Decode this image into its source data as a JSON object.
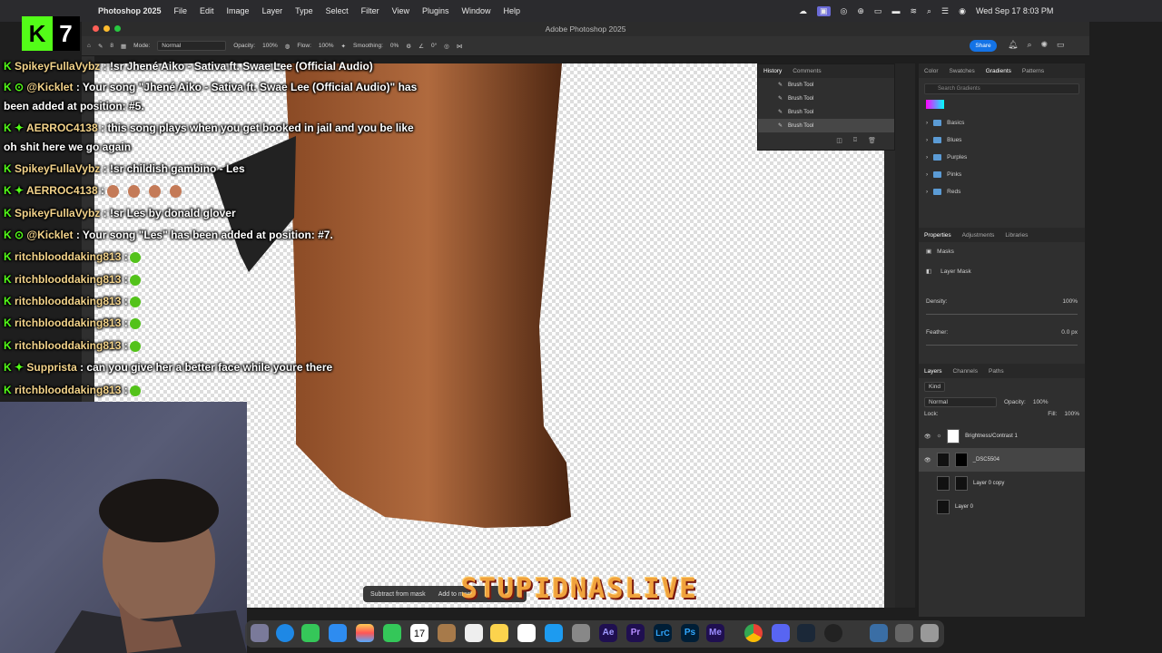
{
  "menubar": {
    "app_name": "Photoshop 2025",
    "items": [
      "File",
      "Edit",
      "Image",
      "Layer",
      "Type",
      "Select",
      "Filter",
      "View",
      "Plugins",
      "Window",
      "Help"
    ],
    "datetime": "Wed Sep 17 8:03 PM"
  },
  "window": {
    "title": "Adobe Photoshop 2025"
  },
  "options": {
    "mode_label": "Mode:",
    "mode_value": "Normal",
    "opacity_label": "Opacity:",
    "opacity_value": "100%",
    "flow_label": "Flow:",
    "flow_value": "100%",
    "smoothing_label": "Smoothing:",
    "smoothing_value": "0%",
    "angle_value": "0°",
    "brush_size": "8",
    "share_label": "Share"
  },
  "history": {
    "tabs": [
      "History",
      "Comments"
    ],
    "items": [
      "Brush Tool",
      "Brush Tool",
      "Brush Tool",
      "Brush Tool"
    ]
  },
  "gradients": {
    "tabs": [
      "Color",
      "Swatches",
      "Gradients",
      "Patterns"
    ],
    "search_placeholder": "Search Gradients",
    "groups": [
      "Basics",
      "Blues",
      "Purples",
      "Pinks",
      "Reds"
    ]
  },
  "properties": {
    "tabs": [
      "Properties",
      "Adjustments",
      "Libraries"
    ],
    "masks_label": "Masks",
    "layer_mask_label": "Layer Mask",
    "density_label": "Density:",
    "density_value": "100%",
    "feather_label": "Feather:",
    "feather_value": "0.0 px"
  },
  "layers": {
    "tabs": [
      "Layers",
      "Channels",
      "Paths"
    ],
    "kind_label": "Kind",
    "blend_mode": "Normal",
    "opacity_label": "Opacity:",
    "opacity_value": "100%",
    "lock_label": "Lock:",
    "fill_label": "Fill:",
    "fill_value": "100%",
    "items": [
      "Brightness/Contrast 1",
      "_DSC5504",
      "Layer 0 copy",
      "Layer 0"
    ]
  },
  "chat": {
    "lines": [
      {
        "user": "SpikeyFullaVybz",
        "text": ": !sr Jhené Aiko - Sativa ft. Swae Lee (Official Audio)"
      },
      {
        "user": "@Kicklet",
        "text": ": Your song \"Jhené Aiko - Sativa ft. Swae Lee (Official Audio)\" has"
      },
      {
        "user": "",
        "text": "been added at position: #5."
      },
      {
        "user": "AERROC4138",
        "text": ": this song plays when you get booked in jail and you be like"
      },
      {
        "user": "",
        "text": "oh shit here we go again"
      },
      {
        "user": "SpikeyFullaVybz",
        "text": ": !sr childish gambino - Les"
      },
      {
        "user": "AERROC4138",
        "text": ":"
      },
      {
        "user": "SpikeyFullaVybz",
        "text": ": !sr Les by donald glover"
      },
      {
        "user": "@Kicklet",
        "text": ": Your song \"Les\" has been added at position: #7."
      },
      {
        "user": "ritchblooddaking813",
        "text": ":"
      },
      {
        "user": "ritchblooddaking813",
        "text": ":"
      },
      {
        "user": "ritchblooddaking813",
        "text": ":"
      },
      {
        "user": "ritchblooddaking813",
        "text": ":"
      },
      {
        "user": "ritchblooddaking813",
        "text": ":"
      },
      {
        "user": "Supprista",
        "text": ": can you give her a better face while youre there"
      },
      {
        "user": "ritchblooddaking813",
        "text": ":"
      }
    ]
  },
  "stream": {
    "kick_number": "7",
    "overlay_text": "STUPIDNASLIVE",
    "subtract_label": "Subtract from mask",
    "add_label": "Add to mask"
  },
  "dock": {
    "calendar_day": "17",
    "apps": [
      "Ae",
      "Pr",
      "LrC",
      "Ps",
      "Me"
    ]
  }
}
